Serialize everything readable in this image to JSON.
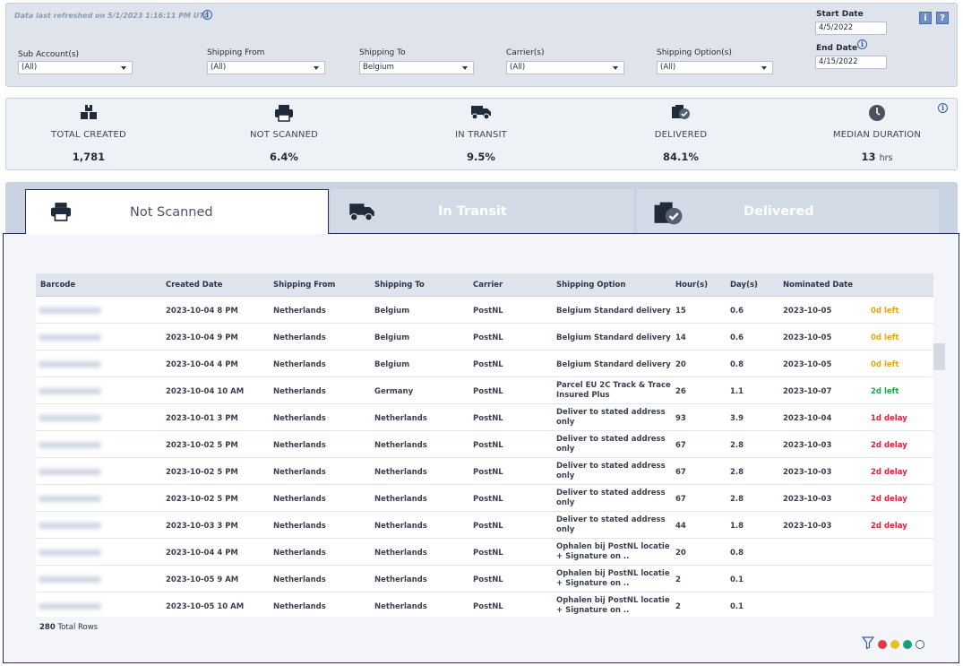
{
  "filters": {
    "refresh_note": "Data last refreshed on 5/1/2023 1:16:11 PM UTC",
    "sub_account": {
      "label": "Sub Account(s)",
      "value": "(All)"
    },
    "shipping_from": {
      "label": "Shipping From",
      "value": "(All)"
    },
    "shipping_to": {
      "label": "Shipping To",
      "value": "Belgium"
    },
    "carrier": {
      "label": "Carrier(s)",
      "value": "(All)"
    },
    "shipping_option": {
      "label": "Shipping Option(s)",
      "value": "(All)"
    },
    "start_date": {
      "label": "Start Date",
      "value": "4/5/2022"
    },
    "end_date": {
      "label": "End Date",
      "value": "4/15/2022"
    },
    "info_button": "i",
    "help_button": "?"
  },
  "kpis": [
    {
      "label": "TOTAL CREATED",
      "value": "1,781",
      "icon": "boxes-icon"
    },
    {
      "label": "NOT SCANNED",
      "value": "6.4%",
      "icon": "printer-icon"
    },
    {
      "label": "IN TRANSIT",
      "value": "9.5%",
      "icon": "truck-icon"
    },
    {
      "label": "DELIVERED",
      "value": "84.1%",
      "icon": "delivered-box-icon"
    },
    {
      "label": "MEDIAN DURATION",
      "value": "13",
      "unit": "hrs",
      "icon": "clock-icon"
    }
  ],
  "tabs": [
    {
      "label": "Not Scanned",
      "active": true
    },
    {
      "label": "In Transit",
      "active": false
    },
    {
      "label": "Delivered",
      "active": false
    }
  ],
  "table": {
    "columns": [
      "Barcode",
      "Created Date",
      "Shipping From",
      "Shipping To",
      "Carrier",
      "Shipping Option",
      "Hour(s)",
      "Day(s)",
      "Nominated Date",
      ""
    ],
    "rows": [
      {
        "created": "2023-10-04 8 PM",
        "from": "Netherlands",
        "to": "Belgium",
        "carrier": "PostNL",
        "option": "Belgium Standard delivery",
        "hours": "15",
        "days": "0.6",
        "nominated": "2023-10-05",
        "status": "0d left",
        "status_type": "left-y"
      },
      {
        "created": "2023-10-04 9 PM",
        "from": "Netherlands",
        "to": "Belgium",
        "carrier": "PostNL",
        "option": "Belgium Standard delivery",
        "hours": "14",
        "days": "0.6",
        "nominated": "2023-10-05",
        "status": "0d left",
        "status_type": "left-y"
      },
      {
        "created": "2023-10-04 4 PM",
        "from": "Netherlands",
        "to": "Belgium",
        "carrier": "PostNL",
        "option": "Belgium Standard delivery",
        "hours": "20",
        "days": "0.8",
        "nominated": "2023-10-05",
        "status": "0d left",
        "status_type": "left-y"
      },
      {
        "created": "2023-10-04 10 AM",
        "from": "Netherlands",
        "to": "Germany",
        "carrier": "PostNL",
        "option": "Parcel EU 2C Track & Trace Insured Plus",
        "hours": "26",
        "days": "1.1",
        "nominated": "2023-10-07",
        "status": "2d left",
        "status_type": "left-g"
      },
      {
        "created": "2023-10-01 3 PM",
        "from": "Netherlands",
        "to": "Netherlands",
        "carrier": "PostNL",
        "option": "Deliver to stated address only",
        "hours": "93",
        "days": "3.9",
        "nominated": "2023-10-04",
        "status": "1d delay",
        "status_type": "delay"
      },
      {
        "created": "2023-10-02 5 PM",
        "from": "Netherlands",
        "to": "Netherlands",
        "carrier": "PostNL",
        "option": "Deliver to stated address only",
        "hours": "67",
        "days": "2.8",
        "nominated": "2023-10-03",
        "status": "2d delay",
        "status_type": "delay"
      },
      {
        "created": "2023-10-02 5 PM",
        "from": "Netherlands",
        "to": "Netherlands",
        "carrier": "PostNL",
        "option": "Deliver to stated address only",
        "hours": "67",
        "days": "2.8",
        "nominated": "2023-10-03",
        "status": "2d delay",
        "status_type": "delay"
      },
      {
        "created": "2023-10-02 5 PM",
        "from": "Netherlands",
        "to": "Netherlands",
        "carrier": "PostNL",
        "option": "Deliver to stated address only",
        "hours": "67",
        "days": "2.8",
        "nominated": "2023-10-03",
        "status": "2d delay",
        "status_type": "delay"
      },
      {
        "created": "2023-10-03 3 PM",
        "from": "Netherlands",
        "to": "Netherlands",
        "carrier": "PostNL",
        "option": "Deliver to stated address only",
        "hours": "44",
        "days": "1.8",
        "nominated": "2023-10-03",
        "status": "2d delay",
        "status_type": "delay"
      },
      {
        "created": "2023-10-04 4 PM",
        "from": "Netherlands",
        "to": "Netherlands",
        "carrier": "PostNL",
        "option": "Ophalen bij PostNL locatie + Signature on ..",
        "hours": "20",
        "days": "0.8",
        "nominated": "",
        "status": "",
        "status_type": ""
      },
      {
        "created": "2023-10-05 9 AM",
        "from": "Netherlands",
        "to": "Netherlands",
        "carrier": "PostNL",
        "option": "Ophalen bij PostNL locatie + Signature on ..",
        "hours": "2",
        "days": "0.1",
        "nominated": "",
        "status": "",
        "status_type": ""
      },
      {
        "created": "2023-10-05 10 AM",
        "from": "Netherlands",
        "to": "Netherlands",
        "carrier": "PostNL",
        "option": "Ophalen bij PostNL locatie + Signature on ..",
        "hours": "2",
        "days": "0.1",
        "nominated": "",
        "status": "",
        "status_type": ""
      }
    ],
    "total_rows_count": "280",
    "total_rows_label": "Total Rows"
  },
  "legend": {
    "colors": [
      "#e03a4a",
      "#e9c021",
      "#16a07a",
      "#ffffff"
    ]
  }
}
